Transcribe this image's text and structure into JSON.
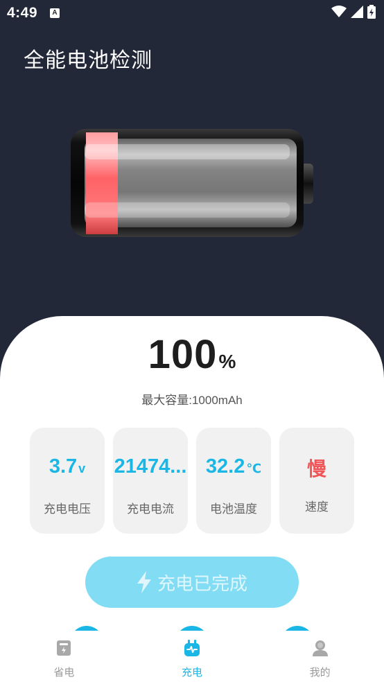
{
  "status_bar": {
    "time": "4:49",
    "notification_icon": "A"
  },
  "app": {
    "title": "全能电池检测"
  },
  "battery": {
    "level_fraction": 0.15,
    "fill_color": "#ff5a5f"
  },
  "percent": {
    "value": "100",
    "unit": "%"
  },
  "capacity": {
    "text": "最大容量:1000mAh"
  },
  "stats": [
    {
      "value": "3.7",
      "unit": "v",
      "label": "充电电压"
    },
    {
      "value": "21474...",
      "unit": "",
      "label": "充电电流"
    },
    {
      "value": "32.2",
      "unit": "℃",
      "label": "电池温度"
    },
    {
      "value": "慢",
      "unit": "",
      "label": "速度"
    }
  ],
  "charge_button": {
    "label": "充电已完成"
  },
  "nav": {
    "items": [
      {
        "label": "省电",
        "icon": "power-save-icon"
      },
      {
        "label": "充电",
        "icon": "charging-plug-icon",
        "active": true
      },
      {
        "label": "我的",
        "icon": "profile-icon"
      }
    ]
  },
  "colors": {
    "accent": "#1ab7e6",
    "background": "#232838",
    "slow": "#f05659",
    "button": "#82dcf4"
  }
}
